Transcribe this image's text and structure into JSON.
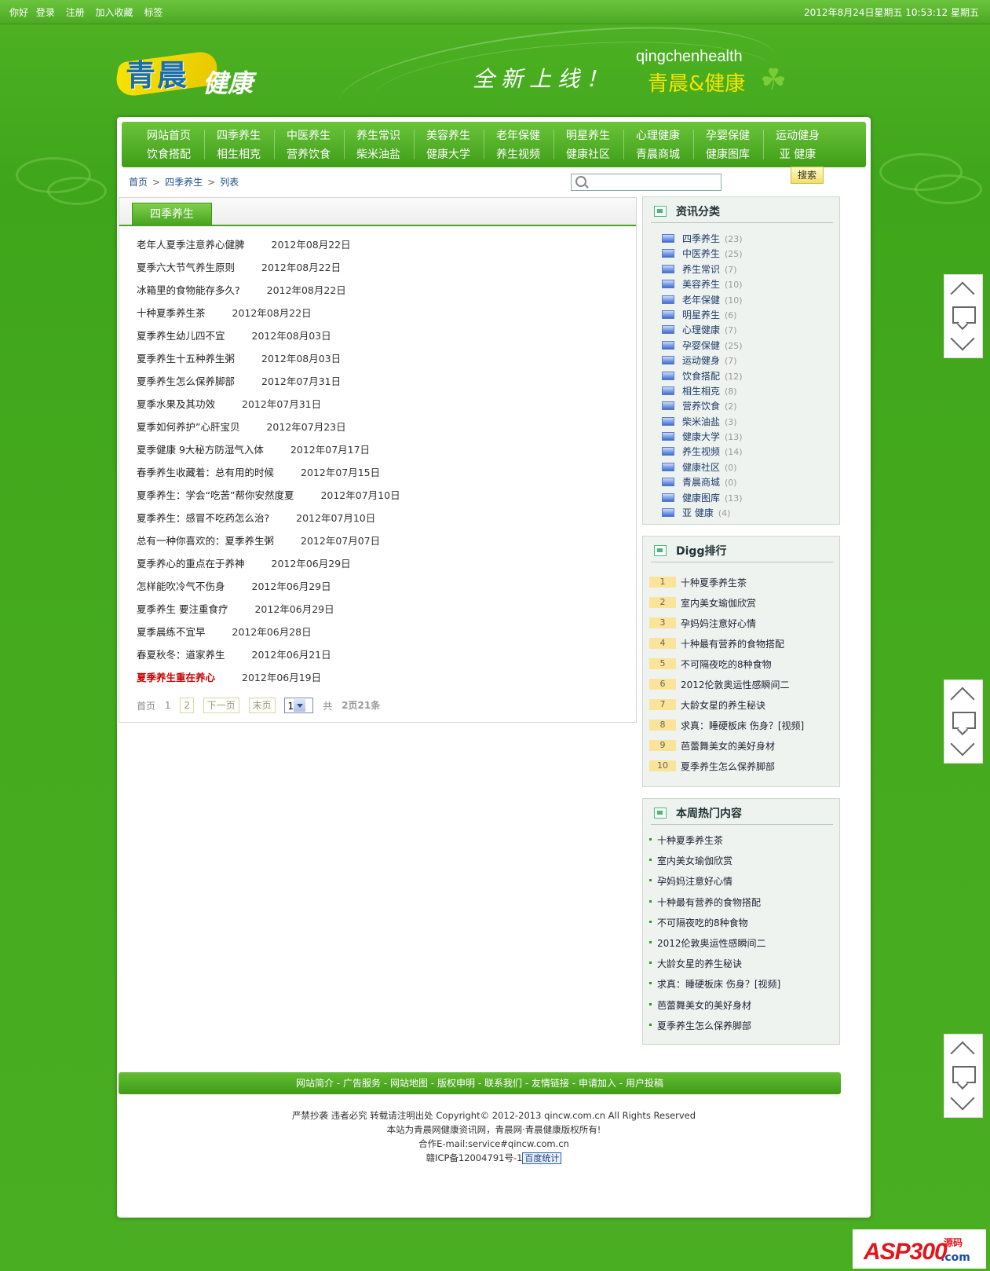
{
  "topbar": {
    "greeting": "你好",
    "login": "登录",
    "register": "注册",
    "favorite": "加入收藏",
    "tags": "标签",
    "clock": "2012年8月24日星期五  10:53:12 星期五"
  },
  "header": {
    "logo_part1": "青晨",
    "logo_part2": "健康",
    "slogan": "全新上线！",
    "en_name": "qingchenhealth",
    "cn_name": "青晨&健康"
  },
  "nav": {
    "row1": [
      "网站首页",
      "四季养生",
      "中医养生",
      "养生常识",
      "美容养生",
      "老年保健",
      "明星养生",
      "心理健康",
      "孕婴保健",
      "运动健身"
    ],
    "row2": [
      "饮食搭配",
      "相生相克",
      "营养饮食",
      "柴米油盐",
      "健康大学",
      "养生视频",
      "健康社区",
      "青晨商城",
      "健康图库",
      "亚  健康"
    ]
  },
  "breadcrumb": [
    "首页",
    "四季养生",
    "列表"
  ],
  "search": {
    "button": "搜索",
    "placeholder": ""
  },
  "main": {
    "tab": "四季养生",
    "items": [
      {
        "title": "老年人夏季注意养心健脾",
        "date": "2012年08月22日"
      },
      {
        "title": "夏季六大节气养生原则",
        "date": "2012年08月22日"
      },
      {
        "title": "冰箱里的食物能存多久?",
        "date": "2012年08月22日"
      },
      {
        "title": "十种夏季养生茶",
        "date": "2012年08月22日"
      },
      {
        "title": "夏季养生幼儿四不宜",
        "date": "2012年08月03日"
      },
      {
        "title": "夏季养生十五种养生粥",
        "date": "2012年08月03日"
      },
      {
        "title": "夏季养生怎么保养脚部",
        "date": "2012年07月31日"
      },
      {
        "title": "夏季水果及其功效",
        "date": "2012年07月31日"
      },
      {
        "title": "夏季如何养护”心肝宝贝",
        "date": "2012年07月23日"
      },
      {
        "title": "夏季健康 9大秘方防湿气入体",
        "date": "2012年07月17日"
      },
      {
        "title": "春季养生收藏着：总有用的时候",
        "date": "2012年07月15日"
      },
      {
        "title": "夏季养生：学会“吃苦”帮你安然度夏",
        "date": "2012年07月10日"
      },
      {
        "title": "夏季养生：感冒不吃药怎么治?",
        "date": "2012年07月10日"
      },
      {
        "title": "总有一种你喜欢的：夏季养生粥",
        "date": "2012年07月07日"
      },
      {
        "title": "夏季养心的重点在于养神",
        "date": "2012年06月29日"
      },
      {
        "title": "怎样能吹冷气不伤身",
        "date": "2012年06月29日"
      },
      {
        "title": "夏季养生 要注重食疗",
        "date": "2012年06月29日"
      },
      {
        "title": "夏季晨练不宜早",
        "date": "2012年06月28日"
      },
      {
        "title": "春夏秋冬：道家养生",
        "date": "2012年06月21日"
      },
      {
        "title": "夏季养生重在养心",
        "date": "2012年06月19日",
        "hot": true
      }
    ]
  },
  "pager": {
    "first": "首页",
    "p1": "1",
    "p2": "2",
    "next": "下一页",
    "last": "末页",
    "select": "1",
    "total_prefix": "共",
    "total_pages": "2页",
    "total_items": "21条"
  },
  "sidebar": {
    "categories_title": "资讯分类",
    "categories": [
      {
        "name": "四季养生",
        "count": "(23)"
      },
      {
        "name": "中医养生",
        "count": "(25)"
      },
      {
        "name": "养生常识",
        "count": "(7)"
      },
      {
        "name": "美容养生",
        "count": "(10)"
      },
      {
        "name": "老年保健",
        "count": "(10)"
      },
      {
        "name": "明星养生",
        "count": "(6)"
      },
      {
        "name": "心理健康",
        "count": "(7)"
      },
      {
        "name": "孕婴保健",
        "count": "(25)"
      },
      {
        "name": "运动健身",
        "count": "(7)"
      },
      {
        "name": "饮食搭配",
        "count": "(12)"
      },
      {
        "name": "相生相克",
        "count": "(8)"
      },
      {
        "name": "营养饮食",
        "count": "(2)"
      },
      {
        "name": "柴米油盐",
        "count": "(3)"
      },
      {
        "name": "健康大学",
        "count": "(13)"
      },
      {
        "name": "养生视频",
        "count": "(14)"
      },
      {
        "name": "健康社区",
        "count": "(0)"
      },
      {
        "name": "青晨商城",
        "count": "(0)"
      },
      {
        "name": "健康图库",
        "count": "(13)"
      },
      {
        "name": "亚  健康",
        "count": "(4)"
      }
    ],
    "digg_title": "Digg排行",
    "digg": [
      {
        "no": "1",
        "title": "十种夏季养生茶"
      },
      {
        "no": "2",
        "title": "室内美女瑜伽欣赏"
      },
      {
        "no": "3",
        "title": "孕妈妈注意好心情"
      },
      {
        "no": "4",
        "title": "十种最有营养的食物搭配"
      },
      {
        "no": "5",
        "title": "不可隔夜吃的8种食物"
      },
      {
        "no": "6",
        "title": "2012伦敦奥运性感瞬间二"
      },
      {
        "no": "7",
        "title": "大龄女星的养生秘诀"
      },
      {
        "no": "8",
        "title": "求真：睡硬板床 伤身？[视频]"
      },
      {
        "no": "9",
        "title": "芭蕾舞美女的美好身材"
      },
      {
        "no": "10",
        "title": "夏季养生怎么保养脚部"
      }
    ],
    "hot_title": "本周热门内容",
    "hot": [
      "十种夏季养生茶",
      "室内美女瑜伽欣赏",
      "孕妈妈注意好心情",
      "十种最有营养的食物搭配",
      "不可隔夜吃的8种食物",
      "2012伦敦奥运性感瞬间二",
      "大龄女星的养生秘诀",
      "求真：睡硬板床 伤身？[视频]",
      "芭蕾舞美女的美好身材",
      "夏季养生怎么保养脚部"
    ]
  },
  "footer": {
    "links": [
      "网站简介",
      "广告服务",
      "网站地图",
      "版权申明",
      "联系我们",
      "友情链接",
      "申请加入",
      "用户投稿"
    ],
    "line1": "严禁抄袭 违者必究 转载请注明出处 Copyright© 2012-2013 qincw.com.cn All Rights Reserved",
    "line2": "本站为青晨网健康资讯网，青晨网·青晨健康版权所有!",
    "line3": "合作E-mail:service#qincw.com.cn",
    "icp": "赣ICP备12004791号-1",
    "stat": "百度统计"
  },
  "watermark": {
    "brand": "ASP300",
    "tag1": "源码",
    "tag2": ".com"
  },
  "colors": {
    "brand_green": "#4aa423",
    "nav_top": "#6ac43b",
    "hot_red": "#cc0000",
    "digg_badge": "#fbe39a"
  }
}
